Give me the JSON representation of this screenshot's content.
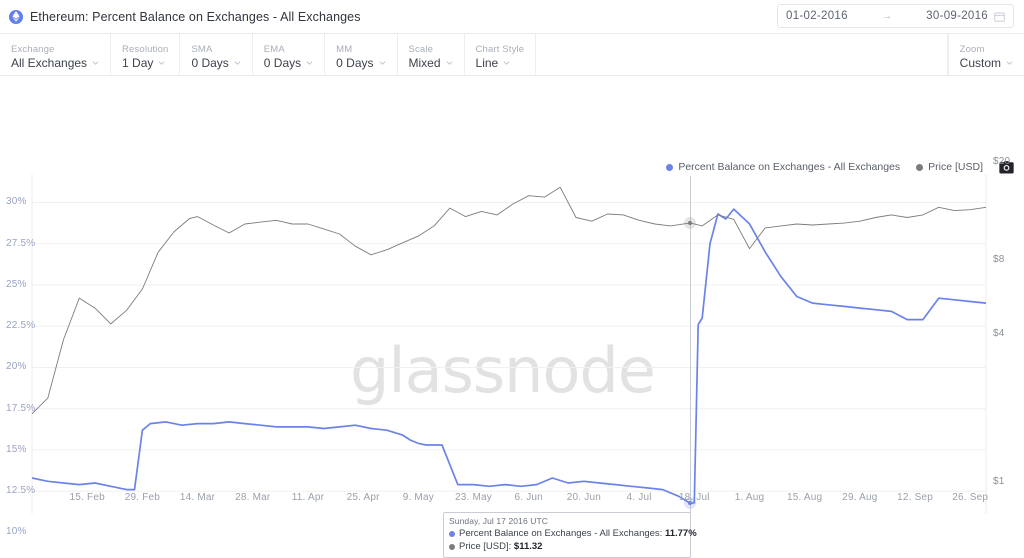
{
  "header": {
    "title": "Ethereum: Percent Balance on Exchanges - All Exchanges",
    "asset_icon": "ethereum-icon",
    "date_start": "01-02-2016",
    "date_end": "30-09-2016",
    "date_arrow": "→",
    "calendar_icon": "calendar-icon"
  },
  "controls": [
    {
      "label": "Exchange",
      "value": "All Exchanges",
      "name": "exchange"
    },
    {
      "label": "Resolution",
      "value": "1 Day",
      "name": "resolution"
    },
    {
      "label": "SMA",
      "value": "0 Days",
      "name": "sma"
    },
    {
      "label": "EMA",
      "value": "0 Days",
      "name": "ema"
    },
    {
      "label": "MM",
      "value": "0 Days",
      "name": "mm"
    },
    {
      "label": "Scale",
      "value": "Mixed",
      "name": "scale"
    },
    {
      "label": "Chart Style",
      "value": "Line",
      "name": "chart-style"
    }
  ],
  "zoom_control": {
    "label": "Zoom",
    "value": "Custom"
  },
  "legend": {
    "items": [
      {
        "label": "Percent Balance on Exchanges - All Exchanges",
        "color": "#6b83e8"
      },
      {
        "label": "Price [USD]",
        "color": "#7c7c7c"
      }
    ],
    "camera_icon": "camera-icon"
  },
  "watermark": "glassnode",
  "tooltip": {
    "date": "Sunday, Jul 17 2016 UTC",
    "rows": [
      {
        "label": "Percent Balance on Exchanges - All Exchanges:",
        "value": "11.77%",
        "color": "#6b83e8"
      },
      {
        "label": "Price [USD]:",
        "value": "$11.32",
        "color": "#7c7c7c"
      }
    ]
  },
  "chart_data": {
    "type": "line",
    "title": "Ethereum: Percent Balance on Exchanges - All Exchanges",
    "xlabel": "",
    "ylabel": "Percent Balance on Exchanges",
    "ylabel_right": "Price [USD]",
    "grid": true,
    "legend_position": "top-right",
    "y_left_ticks": [
      "10%",
      "12.5%",
      "15%",
      "17.5%",
      "20%",
      "22.5%",
      "25%",
      "27.5%",
      "30%"
    ],
    "y_left_values": [
      10,
      12.5,
      15,
      17.5,
      20,
      22.5,
      25,
      27.5,
      30
    ],
    "y_left_range": [
      9.3,
      31.0
    ],
    "y_right_ticks": [
      "$1",
      "$4",
      "$8",
      "$20"
    ],
    "y_right_values": [
      1,
      4,
      8,
      20
    ],
    "y_right_scale": "log",
    "x_ticks": [
      "15. Feb",
      "29. Feb",
      "14. Mar",
      "28. Mar",
      "11. Apr",
      "25. Apr",
      "9. May",
      "23. May",
      "6. Jun",
      "20. Jun",
      "4. Jul",
      "18. Jul",
      "1. Aug",
      "15. Aug",
      "29. Aug",
      "12. Sep",
      "26. Sep"
    ],
    "x_range": [
      "2016-02-01",
      "2016-09-30"
    ],
    "crosshair_x_label": "18. Jul",
    "series": [
      {
        "name": "Percent Balance on Exchanges - All Exchanges",
        "color": "#6b83e8",
        "axis": "left",
        "unit": "%",
        "x": [
          "2016-02-01",
          "2016-02-05",
          "2016-02-09",
          "2016-02-13",
          "2016-02-17",
          "2016-02-21",
          "2016-02-25",
          "2016-02-27",
          "2016-02-29",
          "2016-03-02",
          "2016-03-06",
          "2016-03-10",
          "2016-03-14",
          "2016-03-18",
          "2016-03-22",
          "2016-03-26",
          "2016-03-30",
          "2016-04-03",
          "2016-04-07",
          "2016-04-11",
          "2016-04-15",
          "2016-04-19",
          "2016-04-23",
          "2016-04-27",
          "2016-05-01",
          "2016-05-05",
          "2016-05-07",
          "2016-05-09",
          "2016-05-11",
          "2016-05-15",
          "2016-05-19",
          "2016-05-23",
          "2016-05-27",
          "2016-05-31",
          "2016-06-04",
          "2016-06-08",
          "2016-06-12",
          "2016-06-16",
          "2016-06-20",
          "2016-06-24",
          "2016-06-28",
          "2016-07-02",
          "2016-07-06",
          "2016-07-10",
          "2016-07-14",
          "2016-07-17",
          "2016-07-18",
          "2016-07-19",
          "2016-07-20",
          "2016-07-22",
          "2016-07-24",
          "2016-07-26",
          "2016-07-28",
          "2016-08-01",
          "2016-08-05",
          "2016-08-09",
          "2016-08-13",
          "2016-08-17",
          "2016-08-21",
          "2016-08-25",
          "2016-08-29",
          "2016-09-02",
          "2016-09-06",
          "2016-09-10",
          "2016-09-14",
          "2016-09-18",
          "2016-09-22",
          "2016-09-26",
          "2016-09-30"
        ],
        "values": [
          13.3,
          13.1,
          13.0,
          12.9,
          13.0,
          12.8,
          12.6,
          12.6,
          16.2,
          16.6,
          16.7,
          16.5,
          16.6,
          16.6,
          16.7,
          16.6,
          16.5,
          16.4,
          16.4,
          16.4,
          16.3,
          16.4,
          16.5,
          16.3,
          16.2,
          15.9,
          15.6,
          15.4,
          15.3,
          15.3,
          12.9,
          12.9,
          12.8,
          12.9,
          12.8,
          12.9,
          13.3,
          13.0,
          13.1,
          13.0,
          12.9,
          12.8,
          12.7,
          12.6,
          12.2,
          11.77,
          11.8,
          22.6,
          23.0,
          27.5,
          29.3,
          29.0,
          29.6,
          28.7,
          27.0,
          25.5,
          24.3,
          23.9,
          23.8,
          23.7,
          23.6,
          23.5,
          23.4,
          22.9,
          22.9,
          24.2,
          24.1,
          24.0,
          23.9
        ]
      },
      {
        "name": "Price [USD]",
        "color": "#7c7c7c",
        "axis": "right",
        "unit": "$",
        "x": [
          "2016-02-01",
          "2016-02-05",
          "2016-02-09",
          "2016-02-13",
          "2016-02-17",
          "2016-02-21",
          "2016-02-25",
          "2016-02-29",
          "2016-03-04",
          "2016-03-08",
          "2016-03-12",
          "2016-03-14",
          "2016-03-18",
          "2016-03-22",
          "2016-03-26",
          "2016-03-30",
          "2016-04-03",
          "2016-04-07",
          "2016-04-11",
          "2016-04-15",
          "2016-04-19",
          "2016-04-23",
          "2016-04-27",
          "2016-05-01",
          "2016-05-05",
          "2016-05-09",
          "2016-05-13",
          "2016-05-17",
          "2016-05-21",
          "2016-05-25",
          "2016-05-29",
          "2016-06-02",
          "2016-06-06",
          "2016-06-10",
          "2016-06-14",
          "2016-06-18",
          "2016-06-22",
          "2016-06-26",
          "2016-06-30",
          "2016-07-04",
          "2016-07-08",
          "2016-07-12",
          "2016-07-17",
          "2016-07-20",
          "2016-07-24",
          "2016-07-28",
          "2016-08-01",
          "2016-08-05",
          "2016-08-09",
          "2016-08-13",
          "2016-08-17",
          "2016-08-21",
          "2016-08-25",
          "2016-08-29",
          "2016-09-02",
          "2016-09-06",
          "2016-09-10",
          "2016-09-14",
          "2016-09-18",
          "2016-09-22",
          "2016-09-26",
          "2016-09-30"
        ],
        "values": [
          1.9,
          2.2,
          3.8,
          5.6,
          5.1,
          4.4,
          5.0,
          6.1,
          8.6,
          10.4,
          11.8,
          12.0,
          11.1,
          10.3,
          11.2,
          11.4,
          11.6,
          11.2,
          11.2,
          10.7,
          10.2,
          9.1,
          8.4,
          8.8,
          9.4,
          10.0,
          11.0,
          13.0,
          12.0,
          12.6,
          12.2,
          13.5,
          14.6,
          14.4,
          15.8,
          11.9,
          11.5,
          12.3,
          12.2,
          11.6,
          11.2,
          11.0,
          11.32,
          11.0,
          12.2,
          11.7,
          8.9,
          10.8,
          11.0,
          11.2,
          11.1,
          11.2,
          11.3,
          11.5,
          11.9,
          12.2,
          11.9,
          12.2,
          13.1,
          12.7,
          12.8,
          13.1
        ]
      }
    ]
  }
}
